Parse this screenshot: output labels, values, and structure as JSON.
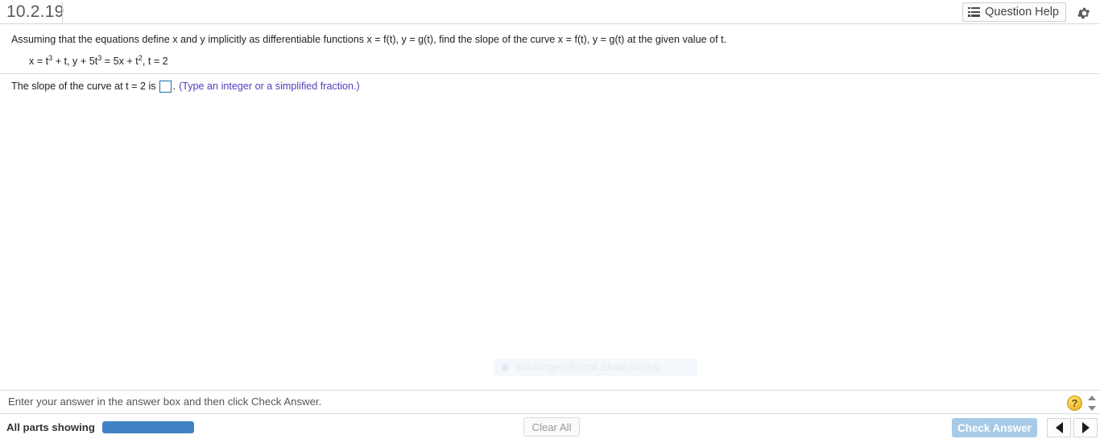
{
  "header": {
    "exercise_id": "10.2.19",
    "question_help_label": "Question Help",
    "question_help_icon": "list-icon",
    "settings_icon": "gear-icon"
  },
  "question": {
    "stem_part1": "Assuming that the equations define x and y implicitly as differentiable functions x = f(t), y = g(t), find the slope of the curve x = f(t), y = g(t) at the given value of t.",
    "equation": {
      "x_def_lead": "x = t",
      "x_def_exp": "3",
      "x_def_tail": " + t, y + 5t",
      "y_exp1": "3",
      "mid": " = 5x + t",
      "t_exp": "2",
      "tail": ", t = 2",
      "plain": "x = t3 + t, y + 5t3 = 5x + t2, t = 2"
    }
  },
  "answer": {
    "prompt": "The slope of the curve at t = 2 is",
    "period": ".",
    "hint": "(Type an integer or a simplified fraction.)",
    "input_value": "",
    "input_placeholder": "",
    "border_color": "#1b6fa8"
  },
  "watermark": {
    "text": "Dikdörtgen Biçimli Ekran Alıntısı"
  },
  "footer": {
    "instruction": "Enter your answer in the answer box and then click Check Answer.",
    "help_icon_glyph": "?",
    "spinner_icon": "up-down-spinner",
    "parts_label": "All parts showing",
    "progress_percent": 100,
    "progress_color": "#3f83c4",
    "clear_all_label": "Clear All",
    "check_answer_label": "Check Answer",
    "check_answer_color": "#a7cbe7",
    "prev_icon": "triangle-left-icon",
    "next_icon": "triangle-right-icon"
  }
}
